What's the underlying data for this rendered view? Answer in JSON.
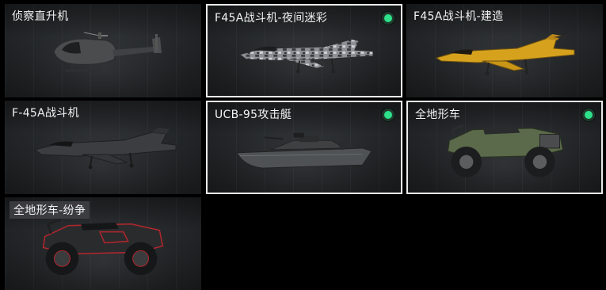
{
  "cards": [
    {
      "title": "侦察直升机",
      "selected": false,
      "owned": false,
      "vehicle_icon": "helicopter-icon"
    },
    {
      "title": "F45A战斗机-夜间迷彩",
      "selected": true,
      "owned": true,
      "vehicle_icon": "fighter-jet-camo-icon"
    },
    {
      "title": "F45A战斗机-建造",
      "selected": false,
      "owned": false,
      "vehicle_icon": "fighter-jet-gold-icon"
    },
    {
      "title": "F-45A战斗机",
      "selected": false,
      "owned": false,
      "vehicle_icon": "fighter-jet-icon"
    },
    {
      "title": "UCB-95攻击艇",
      "selected": true,
      "owned": true,
      "vehicle_icon": "attack-boat-icon"
    },
    {
      "title": "全地形车",
      "selected": true,
      "owned": true,
      "vehicle_icon": "atv-icon"
    },
    {
      "title": "全地形车-纷争",
      "selected": false,
      "owned": false,
      "vehicle_icon": "atv-red-icon"
    }
  ],
  "colors": {
    "owned_indicator": "#2fe08a",
    "selected_border": "#e9e9e9",
    "background": "#000000"
  }
}
